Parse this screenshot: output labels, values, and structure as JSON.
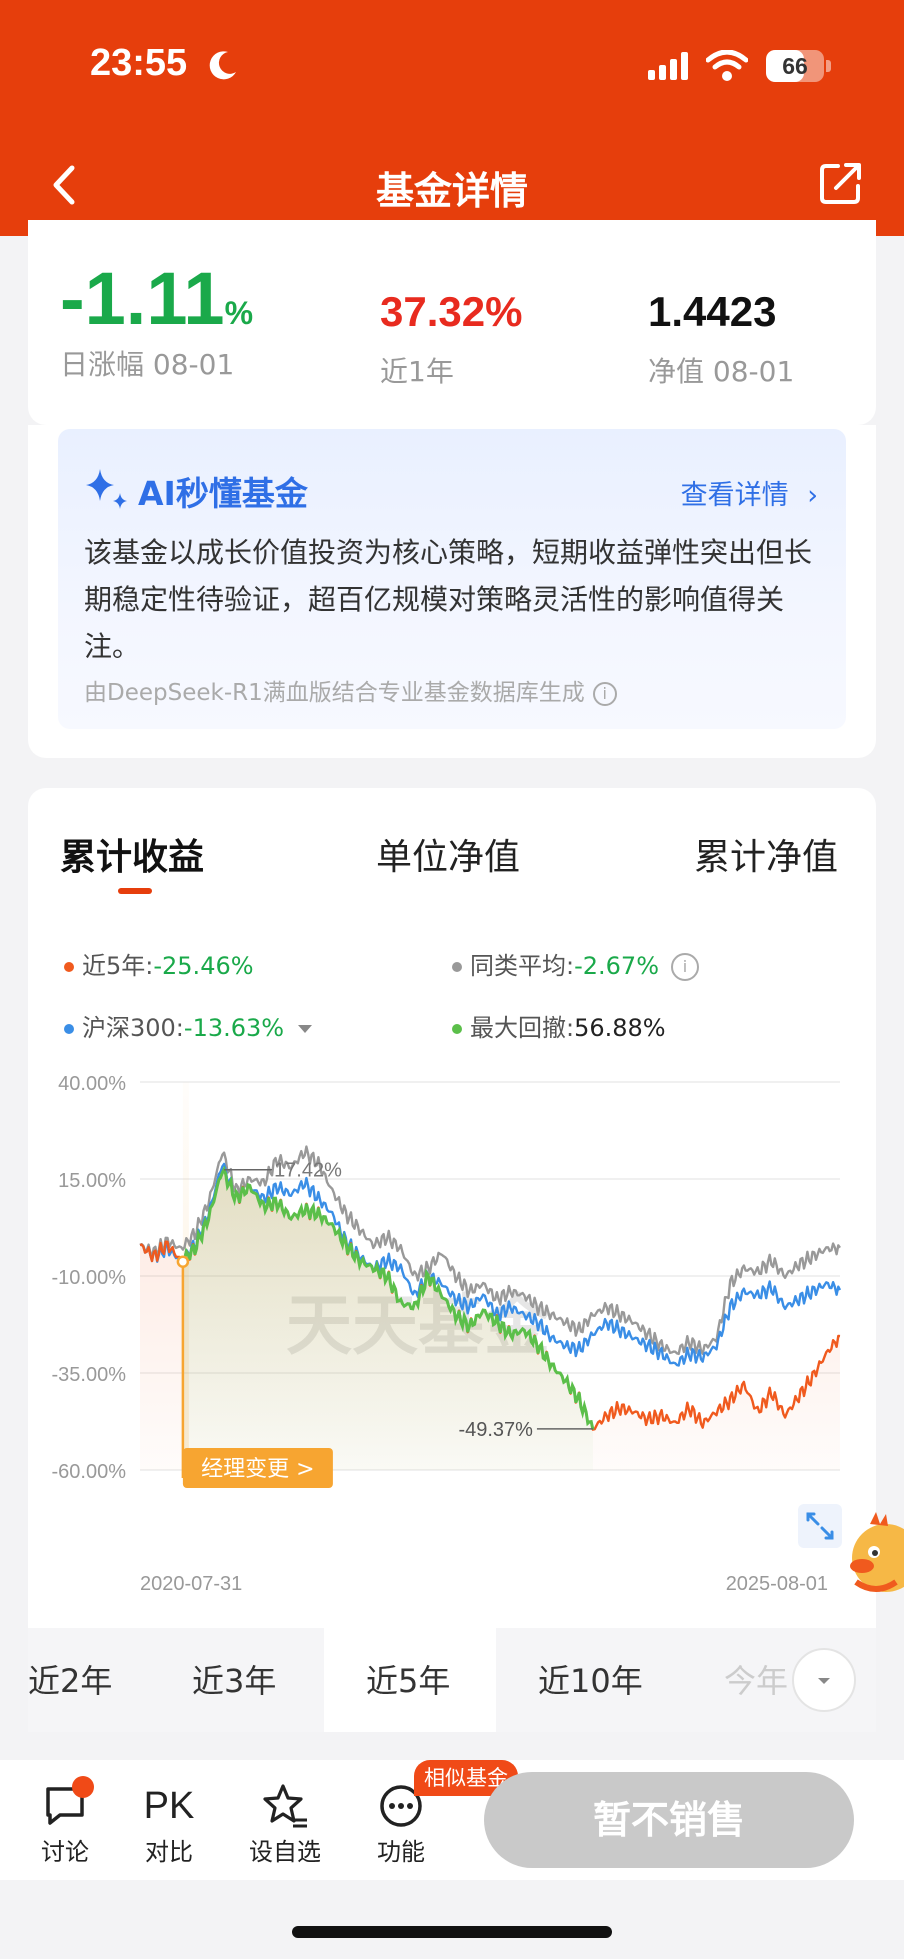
{
  "status": {
    "time": "23:55",
    "battery": "66",
    "battery_level": 0.66
  },
  "nav": {
    "title": "基金详情"
  },
  "stats": {
    "daily_change_value": "-1.11",
    "daily_change_unit": "%",
    "daily_change_label": "日涨幅 08-01",
    "year_return": "37.32%",
    "year_label": "近1年",
    "nav_value": "1.4423",
    "nav_label": "净值 08-01"
  },
  "ai": {
    "title": "AI秒懂基金",
    "more": "查看详情",
    "body": "该基金以成长价值投资为核心策略，短期收益弹性突出但长期稳定性待验证，超百亿规模对策略灵活性的影响值得关注。",
    "source": "由DeepSeek-R1满血版结合专业基金数据库生成"
  },
  "chart_tabs": [
    "累计收益",
    "单位净值",
    "累计净值"
  ],
  "legend": {
    "fund_label": "近5年:",
    "fund_value": "-25.46%",
    "avg_label": "同类平均:",
    "avg_value": "-2.67%",
    "index_label": "沪深300:",
    "index_value": "-13.63%",
    "drawdown_label": "最大回撤:",
    "drawdown_value": "56.88%"
  },
  "colors": {
    "fund": "#f05a1e",
    "average": "#999999",
    "index": "#3a8ee6",
    "drawdown": "#5bbf4a",
    "brand": "#e63e0c"
  },
  "chart_data": {
    "type": "line",
    "y_ticks": [
      "40.00%",
      "15.00%",
      "-10.00%",
      "-35.00%",
      "-60.00%"
    ],
    "ylim": [
      -60,
      40
    ],
    "x_start": "2020-07-31",
    "x_end": "2025-08-01",
    "annotations": {
      "peak": "17.42%",
      "trough": "-49.37%",
      "manager_change": "经理变更 >"
    },
    "watermark": "天天基金",
    "series": [
      {
        "name": "近5年",
        "values": [
          -2,
          -5,
          -2,
          -6,
          -3,
          5,
          17.4,
          10,
          13,
          8,
          9,
          5,
          7,
          6,
          3,
          -2,
          -6,
          -8,
          -10,
          -17,
          -18,
          -10,
          -15,
          -20,
          -23,
          -19,
          -22,
          -25,
          -24,
          -28,
          -33,
          -37,
          -42,
          -49.4,
          -46,
          -44,
          -45,
          -47,
          -46,
          -48,
          -44,
          -48,
          -45,
          -42,
          -38,
          -45,
          -40,
          -46,
          -41,
          -36,
          -30,
          -25.5
        ]
      },
      {
        "name": "同类平均",
        "values": [
          -2,
          -4,
          -1,
          -3,
          1,
          9,
          22,
          12,
          15,
          14,
          20,
          18,
          22,
          19,
          12,
          6,
          2,
          -2,
          0,
          -3,
          -10,
          -8,
          -4,
          -10,
          -14,
          -12,
          -16,
          -14,
          -15,
          -18,
          -20,
          -22,
          -24,
          -20,
          -18,
          -20,
          -22,
          -25,
          -28,
          -30,
          -27,
          -29,
          -26,
          -12,
          -8,
          -9,
          -6,
          -10,
          -7,
          -5,
          -3,
          -2.7
        ]
      },
      {
        "name": "沪深300",
        "values": [
          -2,
          -5,
          -3,
          -6,
          -2,
          6,
          19,
          10,
          13,
          10,
          13,
          11,
          14,
          10,
          6,
          -1,
          -5,
          -8,
          -6,
          -8,
          -15,
          -10,
          -12,
          -16,
          -18,
          -15,
          -20,
          -18,
          -20,
          -22,
          -26,
          -28,
          -29,
          -25,
          -22,
          -24,
          -26,
          -28,
          -30,
          -33,
          -30,
          -31,
          -28,
          -18,
          -14,
          -15,
          -13,
          -18,
          -16,
          -14,
          -12,
          -13.6
        ]
      }
    ],
    "max_drawdown": "56.88%",
    "legend_position": "top"
  },
  "periods": [
    "近2年",
    "近3年",
    "近5年",
    "近10年",
    "今年"
  ],
  "active_period": "近5年",
  "bottom": {
    "discuss": "讨论",
    "compare_icon_text": "PK",
    "compare": "对比",
    "watch": "设自选",
    "features": "功能",
    "similar": "相似基金",
    "no_sale": "暂不销售"
  }
}
